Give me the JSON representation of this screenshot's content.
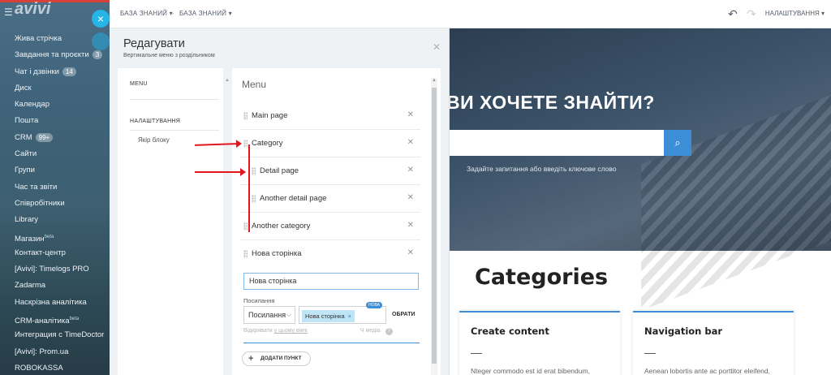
{
  "sidebar": {
    "logo": "avivi",
    "items": [
      {
        "label": "Жива стрічка",
        "badge": ""
      },
      {
        "label": "Завдання та проєкти",
        "badge": "3"
      },
      {
        "label": "Чат і дзвінки",
        "badge": "14"
      },
      {
        "label": "Диск",
        "badge": ""
      },
      {
        "label": "Календар",
        "badge": ""
      },
      {
        "label": "Пошта",
        "badge": ""
      },
      {
        "label": "CRM",
        "badge": "99+"
      },
      {
        "label": "Сайти",
        "badge": ""
      },
      {
        "label": "Групи",
        "badge": ""
      },
      {
        "label": "Час та звіти",
        "badge": ""
      },
      {
        "label": "Співробітники",
        "badge": ""
      },
      {
        "label": "Library",
        "badge": ""
      },
      {
        "label": "Магазин",
        "badge": "",
        "sup": "beta"
      },
      {
        "label": "Контакт-центр",
        "badge": ""
      },
      {
        "label": "[Avivi]: Timelogs PRO",
        "badge": ""
      },
      {
        "label": "Zadarma",
        "badge": ""
      },
      {
        "label": "Наскрізна аналітика",
        "badge": ""
      },
      {
        "label": "CRM-аналітика",
        "badge": "",
        "sup": "beta"
      },
      {
        "label": "Интеграция с TimeDoctor",
        "badge": ""
      },
      {
        "label": "[Avivi]: Prom.ua",
        "badge": ""
      },
      {
        "label": "ROBOKASSA",
        "badge": ""
      }
    ]
  },
  "topbar": {
    "crumb1": "БАЗА ЗНАНИЙ",
    "crumb2": "БАЗА ЗНАНИЙ",
    "settings": "НАЛАШТУВАННЯ"
  },
  "panel": {
    "title": "Редагувати",
    "subtitle": "Вертикальне меню з роздільником",
    "left": {
      "menu": "MENU",
      "settings": "НАЛАШТУВАННЯ",
      "anchor": "Якір блоку"
    },
    "menu_heading": "Menu",
    "items": [
      {
        "label": "Main page",
        "level": 0
      },
      {
        "label": "Category",
        "level": 0
      },
      {
        "label": "Detail page",
        "level": 1
      },
      {
        "label": "Another detail page",
        "level": 1
      },
      {
        "label": "Another category",
        "level": 0
      },
      {
        "label": "Нова сторінка",
        "level": 0
      }
    ],
    "edit_value": "Нова сторінка",
    "link_label": "Посилання",
    "link_type": "Посилання",
    "link_tag": "Нова сторінка",
    "new_badge": "НОВА",
    "choose": "ОБРАТИ",
    "open_prefix": "Відкривати",
    "open_link": "у цьому вікні",
    "mode": "Ч медіа",
    "add_button": "ДОДАТИ ПУНКТ"
  },
  "preview": {
    "hero_title": "ВИ ХОЧЕТЕ ЗНАЙТИ?",
    "hint": "Задайте запитання або введіть ключове слово",
    "categories": "Categories",
    "cards": [
      {
        "title": "Create content",
        "text": "Nteger commodo est id erat bibendum,"
      },
      {
        "title": "Navigation bar",
        "text": "Aenean lobortis ante ac porttitor eleifend,"
      }
    ]
  },
  "colors": {
    "accent": "#3c8ed6",
    "annotation": "#e3161b",
    "close_button": "#27b4e6"
  }
}
